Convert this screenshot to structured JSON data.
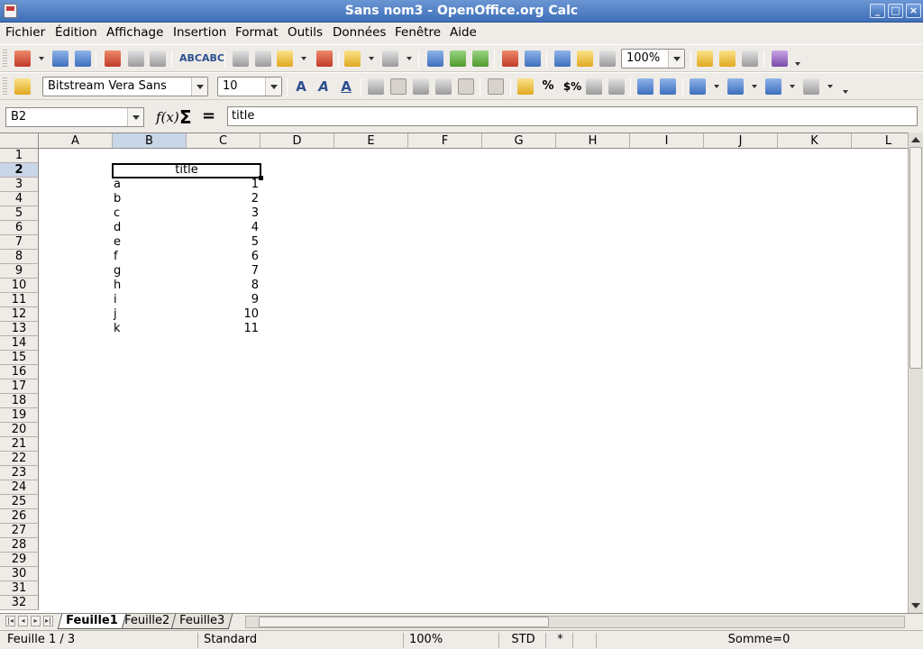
{
  "window": {
    "title": "Sans nom3 - OpenOffice.org Calc",
    "buttons": {
      "minimize": "_",
      "maximize": "□",
      "close": "×"
    }
  },
  "menubar": {
    "items": [
      "Fichier",
      "Édition",
      "Affichage",
      "Insertion",
      "Format",
      "Outils",
      "Données",
      "Fenêtre",
      "Aide"
    ]
  },
  "standard_toolbar": {
    "zoom_value": "100%",
    "icons": [
      "new-icon",
      "open-icon",
      "save-icon",
      "export-pdf-icon",
      "print-icon",
      "page-preview-icon",
      "spellcheck-icon",
      "autospellcheck-icon",
      "cut-icon",
      "copy-icon",
      "paste-icon",
      "format-paintbrush-icon",
      "undo-icon",
      "redo-icon",
      "hyperlink-icon",
      "sort-ascending-icon",
      "sort-descending-icon",
      "chart-icon",
      "draw-functions-icon",
      "navigator-icon",
      "gallery-icon",
      "data-sources-icon",
      "zoom-icon",
      "edit-file-icon",
      "insert-icon",
      "insert-object-icon",
      "help-icon"
    ]
  },
  "formatting_toolbar": {
    "font_name": "Bitstream Vera Sans",
    "font_size": "10",
    "percent_label": "%",
    "currency_label": "$%"
  },
  "formula_bar": {
    "name_box": "B2",
    "function_wizard_icon": "fx-icon",
    "sum_symbol": "Σ",
    "equals_symbol": "=",
    "formula_content": "title"
  },
  "grid": {
    "columns": [
      "A",
      "B",
      "C",
      "D",
      "E",
      "F",
      "G",
      "H",
      "I",
      "J",
      "K",
      "L"
    ],
    "selected_column": "B",
    "rows": [
      "1",
      "2",
      "3",
      "4",
      "5",
      "6",
      "7",
      "8",
      "9",
      "10",
      "11",
      "12",
      "13",
      "14",
      "15",
      "16",
      "17",
      "18",
      "19",
      "20",
      "21",
      "22",
      "23",
      "24",
      "25",
      "26",
      "27",
      "28",
      "29",
      "30",
      "31",
      "32"
    ],
    "selected_row": "2",
    "title_cell": "title",
    "data_rows": [
      {
        "label": "a",
        "value": "1"
      },
      {
        "label": "b",
        "value": "2"
      },
      {
        "label": "c",
        "value": "3"
      },
      {
        "label": "d",
        "value": "4"
      },
      {
        "label": "e",
        "value": "5"
      },
      {
        "label": "f",
        "value": "6"
      },
      {
        "label": "g",
        "value": "7"
      },
      {
        "label": "h",
        "value": "8"
      },
      {
        "label": "i",
        "value": "9"
      },
      {
        "label": "j",
        "value": "10"
      },
      {
        "label": "k",
        "value": "11"
      }
    ]
  },
  "sheet_tabs": {
    "tabs": [
      "Feuille1",
      "Feuille2",
      "Feuille3"
    ],
    "active": "Feuille1"
  },
  "statusbar": {
    "sheet_position": "Feuille 1 / 3",
    "page_style": "Standard",
    "zoom": "100%",
    "selection_mode": "STD",
    "modified_indicator": "*",
    "sum": "Somme=0"
  },
  "colors": {
    "titlebar": "#3f6fb8",
    "selected_header": "#c9d6e8",
    "background": "#efebe7"
  }
}
